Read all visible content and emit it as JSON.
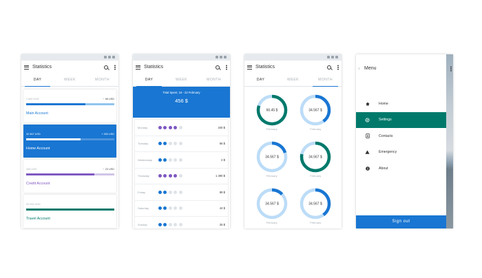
{
  "colors": {
    "primary": "#1976d2",
    "light_blue": "#90c4ee",
    "purple": "#7e57c2",
    "light_purple": "#d1c4e9",
    "teal": "#00796b",
    "track": "#e4e8ec"
  },
  "common": {
    "title": "Statistics",
    "tabs": [
      "DAY",
      "WEEK",
      "MONTH"
    ]
  },
  "screen1": {
    "active_tab": "DAY",
    "accounts": [
      {
        "name": "Main Account",
        "balance": "1 890 USD",
        "change": "− 98 USD",
        "progress": 0.67,
        "secondary": 0.33,
        "color": "#1976d2",
        "secondary_color": "#90c4ee",
        "selected": false
      },
      {
        "name": "Home Account",
        "balance": "32 567 USD",
        "change": "+ 300 USD",
        "progress": 0.62,
        "secondary": 0,
        "color": "#ffffff",
        "secondary_color": "",
        "selected": true
      },
      {
        "name": "Credit Account",
        "balance": "345 USD",
        "change": "− 23 USD",
        "progress": 0.77,
        "secondary": 0.23,
        "color": "#7e57c2",
        "secondary_color": "#d1c4e9",
        "selected": false
      },
      {
        "name": "Travel Account",
        "balance": "39 000 USD",
        "change": "",
        "progress": 1,
        "secondary": 0,
        "color": "#00796b",
        "secondary_color": "",
        "selected": false
      }
    ]
  },
  "screen2": {
    "active_tab": "DAY",
    "period": "Total Spent, 16 - 22 February",
    "total": "456 $",
    "days": [
      {
        "day": "Monday",
        "dots": 4,
        "color": "#7e57c2",
        "amount": "340 $"
      },
      {
        "day": "Tuesday",
        "dots": 2,
        "color": "#1976d2",
        "amount": "56 $"
      },
      {
        "day": "Wednesday",
        "dots": 2,
        "color": "#1976d2",
        "amount": "2 $"
      },
      {
        "day": "Thursday",
        "dots": 4,
        "color": "#7e57c2",
        "amount": "1 390 $"
      },
      {
        "day": "Friday",
        "dots": 2,
        "color": "#1976d2",
        "amount": "89 $"
      },
      {
        "day": "Saturday",
        "dots": 2,
        "color": "#1976d2",
        "amount": "44 $"
      },
      {
        "day": "Sunday",
        "dots": 2,
        "color": "#1976d2",
        "amount": "25 $"
      }
    ]
  },
  "screen3": {
    "active_tab": "MONTH",
    "donuts": [
      {
        "value": "66.45 $",
        "month": "February",
        "fraction": 0.8,
        "color": "#00796b"
      },
      {
        "value": "34.567 $",
        "month": "February",
        "fraction": 0.4,
        "color": "#1976d2"
      },
      {
        "value": "34.567 $",
        "month": "February",
        "fraction": 0.2,
        "color": "#1976d2"
      },
      {
        "value": "34.567 $",
        "month": "February",
        "fraction": 0.78,
        "color": "#00796b"
      },
      {
        "value": "34.567 $",
        "month": "February",
        "fraction": 0.13,
        "color": "#1976d2"
      },
      {
        "value": "34.567 $",
        "month": "February",
        "fraction": 0.4,
        "color": "#1976d2"
      }
    ]
  },
  "screen4": {
    "menu_title": "Menu",
    "items": [
      {
        "label": "Home",
        "icon": "home-icon",
        "active": false
      },
      {
        "label": "Settings",
        "icon": "gear-icon",
        "active": true
      },
      {
        "label": "Contacts",
        "icon": "contacts-icon",
        "active": false
      },
      {
        "label": "Emergency",
        "icon": "warning-icon",
        "active": false
      },
      {
        "label": "About",
        "icon": "info-icon",
        "active": false
      }
    ],
    "sign_out": "Sign out"
  }
}
